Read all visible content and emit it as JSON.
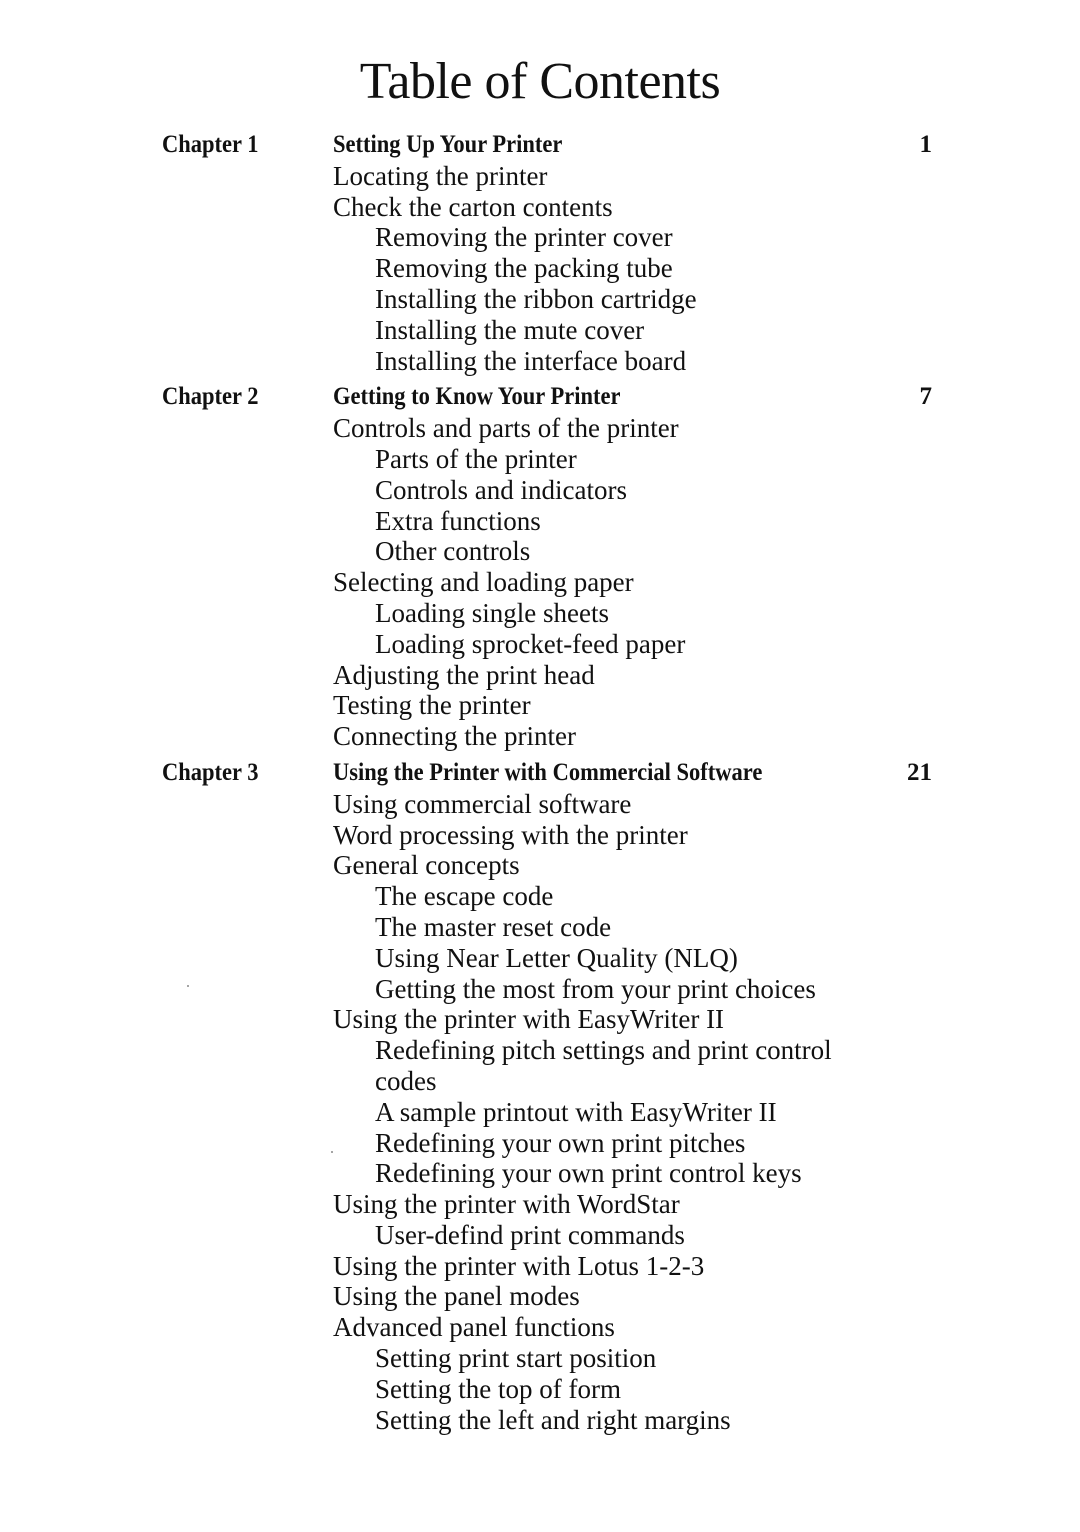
{
  "title": "Table of Contents",
  "chapters": [
    {
      "label": "Chapter 1",
      "title": "Setting Up Your Printer",
      "page": "1",
      "entries": [
        {
          "text": "Locating the printer",
          "level": 1
        },
        {
          "text": "Check the carton contents",
          "level": 1
        },
        {
          "text": "Removing the printer cover",
          "level": 2
        },
        {
          "text": "Removing the packing tube",
          "level": 2
        },
        {
          "text": "Installing the ribbon cartridge",
          "level": 2
        },
        {
          "text": "Installing the mute cover",
          "level": 2
        },
        {
          "text": "Installing the interface board",
          "level": 2
        }
      ]
    },
    {
      "label": "Chapter 2",
      "title": "Getting to Know Your Printer",
      "page": "7",
      "entries": [
        {
          "text": "Controls and parts of the printer",
          "level": 1
        },
        {
          "text": "Parts of the printer",
          "level": 2
        },
        {
          "text": "Controls and indicators",
          "level": 2
        },
        {
          "text": "Extra functions",
          "level": 2
        },
        {
          "text": "Other controls",
          "level": 2
        },
        {
          "text": "Selecting and loading paper",
          "level": 1
        },
        {
          "text": "Loading single sheets",
          "level": 2
        },
        {
          "text": "Loading sprocket-feed paper",
          "level": 2
        },
        {
          "text": "Adjusting the print head",
          "level": 1
        },
        {
          "text": "Testing the printer",
          "level": 1
        },
        {
          "text": "Connecting the printer",
          "level": 1
        }
      ]
    },
    {
      "label": "Chapter 3",
      "title": "Using the Printer with Commercial Software",
      "page": "21",
      "entries": [
        {
          "text": "Using commercial software",
          "level": 1
        },
        {
          "text": "Word processing with the printer",
          "level": 1
        },
        {
          "text": "General concepts",
          "level": 1
        },
        {
          "text": "The escape code",
          "level": 2
        },
        {
          "text": "The master reset code",
          "level": 2
        },
        {
          "text": "Using Near Letter Quality (NLQ)",
          "level": 2
        },
        {
          "text": "Getting the most from your print choices",
          "level": 2
        },
        {
          "text": "Using the printer with EasyWriter II",
          "level": 1
        },
        {
          "text": "Redefining pitch settings and print control",
          "level": 2
        },
        {
          "text": "codes",
          "level": 2
        },
        {
          "text": "A sample printout with EasyWriter II",
          "level": 2
        },
        {
          "text": "Redefining your own print pitches",
          "level": 2
        },
        {
          "text": "Redefining your own print control keys",
          "level": 2
        },
        {
          "text": "Using the printer with WordStar",
          "level": 1
        },
        {
          "text": "User-defind print commands",
          "level": 2
        },
        {
          "text": "Using the printer with Lotus 1-2-3",
          "level": 1
        },
        {
          "text": "Using the panel modes",
          "level": 1
        },
        {
          "text": "Advanced panel functions",
          "level": 1
        },
        {
          "text": "Setting print start position",
          "level": 2
        },
        {
          "text": "Setting the top of form",
          "level": 2
        },
        {
          "text": "Setting the left and right margins",
          "level": 2
        }
      ]
    }
  ]
}
